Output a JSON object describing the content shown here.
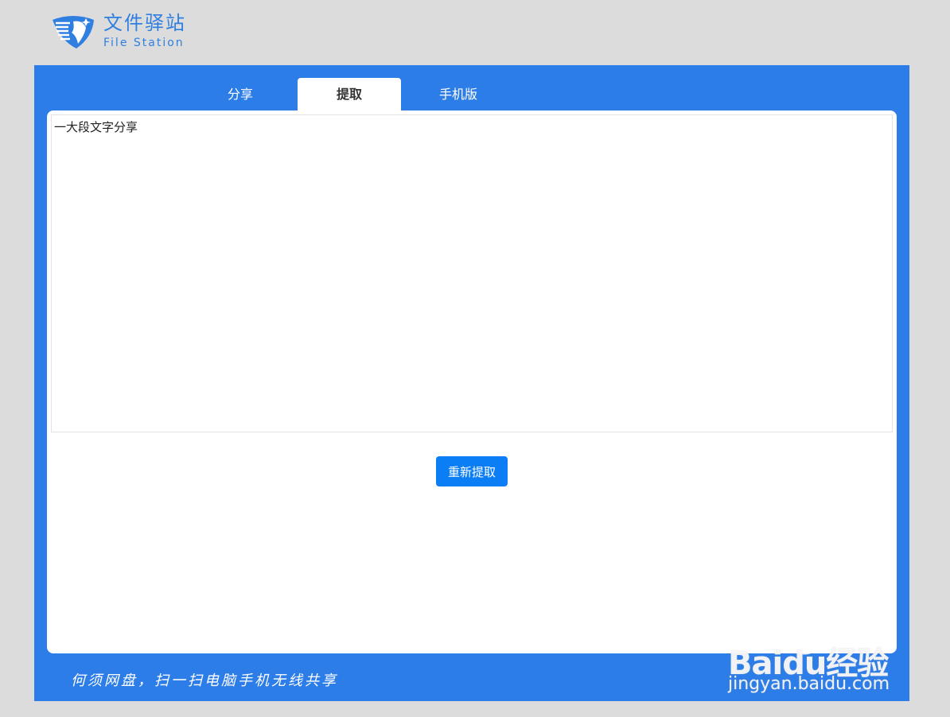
{
  "logo": {
    "cn": "文件驿站",
    "en": "File Station"
  },
  "tabs": [
    {
      "label": "分享",
      "active": false
    },
    {
      "label": "提取",
      "active": true
    },
    {
      "label": "手机版",
      "active": false
    }
  ],
  "content": {
    "text": "一大段文字分享"
  },
  "actions": {
    "re_extract_label": "重新提取"
  },
  "footer": {
    "slogan": "何须网盘，扫一扫电脑手机无线共享"
  },
  "watermark": {
    "brand": "Baidu经验",
    "url": "jingyan.baidu.com"
  },
  "colors": {
    "page_bg": "#dcdcdc",
    "panel_blue": "#2d7de9",
    "button_blue": "#0b7ef6",
    "logo_blue": "#2f7fe0"
  }
}
